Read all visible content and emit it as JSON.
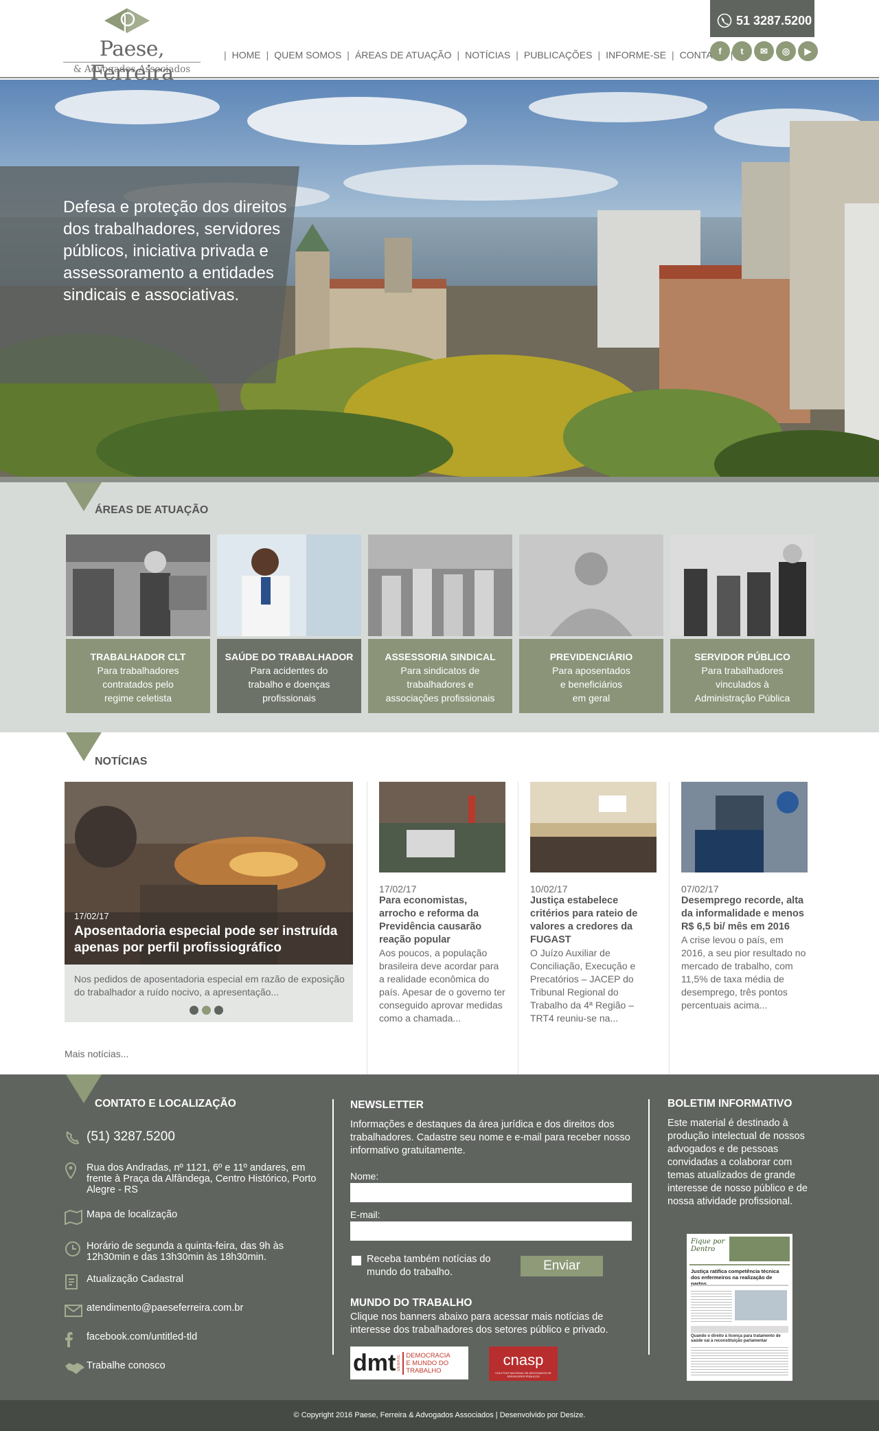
{
  "header": {
    "logo_name": "Paese, Ferreira",
    "logo_sub": "& Advogados Associados",
    "phone": "51 3287.5200",
    "nav": [
      "HOME",
      "QUEM SOMOS",
      "ÁREAS DE ATUAÇÃO",
      "NOTÍCIAS",
      "PUBLICAÇÕES",
      "INFORME-SE",
      "CONTATO"
    ],
    "social": [
      "facebook-icon",
      "twitter-icon",
      "email-icon",
      "instagram-icon",
      "youtube-icon"
    ]
  },
  "hero": {
    "text": "Defesa e proteção dos direitos dos trabalhadores, servidores públicos, iniciativa privada e assessoramento a entidades sindicais e associativas."
  },
  "areas": {
    "title": "ÁREAS DE ATUAÇÃO",
    "items": [
      {
        "title": "TRABALHADOR CLT",
        "desc1": "Para trabalhadores",
        "desc2": "contratados pelo",
        "desc3": "regime celetista"
      },
      {
        "title": "SAÚDE DO TRABALHADOR",
        "desc1": "Para acidentes do",
        "desc2": "trabalho e doenças",
        "desc3": "profissionais"
      },
      {
        "title": "ASSESSORIA SINDICAL",
        "desc1": "Para sindicatos de",
        "desc2": "trabalhadores e",
        "desc3": "associações profissionais"
      },
      {
        "title": "PREVIDENCIÁRIO",
        "desc1": "Para aposentados",
        "desc2": "e beneficiários",
        "desc3": "em geral"
      },
      {
        "title": "SERVIDOR PÚBLICO",
        "desc1": "Para trabalhadores",
        "desc2": "vinculados à",
        "desc3": "Administração Pública"
      }
    ]
  },
  "news": {
    "title": "NOTÍCIAS",
    "featured": {
      "date": "17/02/17",
      "title": "Aposentadoria especial pode ser instruída apenas por perfil profissiográfico",
      "summary": "Nos pedidos de aposentadoria especial em razão de exposição do trabalhador a ruído nocivo, a apresentação..."
    },
    "items": [
      {
        "date": "17/02/17",
        "title": "Para economistas, arrocho e reforma da Previdência causarão reação popular",
        "summary": "Aos poucos, a população brasileira deve acordar para a realidade econômica do país. Apesar de o governo ter conseguido aprovar medidas como a chamada..."
      },
      {
        "date": "10/02/17",
        "title": "Justiça estabelece critérios para rateio de valores a credores da FUGAST",
        "summary": "O Juízo Auxiliar de Conciliação, Execução e Precatórios – JACEP do Tribunal Regional do Trabalho da 4ª Região – TRT4 reuniu-se na..."
      },
      {
        "date": "07/02/17",
        "title": "Desemprego recorde, alta da informalidade e menos R$ 6,5 bi/ mês em 2016",
        "summary": "A crise levou o país, em 2016, a seu pior resultado no mercado de trabalho, com 11,5% de taxa média de desemprego, três pontos percentuais acima..."
      }
    ],
    "more": "Mais notícias..."
  },
  "footer": {
    "contact_title": "CONTATO E LOCALIZAÇÃO",
    "phone": "(51) 3287.5200",
    "address": "Rua dos Andradas, nº 1121, 6º e 11º andares, em frente à Praça da Alfândega, Centro Histórico, Porto Alegre - RS",
    "map": "Mapa de localização",
    "hours": "Horário de segunda a quinta-feira, das 9h às 12h30min e das 13h30min às 18h30min.",
    "update": "Atualização Cadastral",
    "email": "atendimento@paeseferreira.com.br",
    "facebook": "facebook.com/untitled-tld",
    "work": "Trabalhe conosco",
    "newsletter_title": "NEWSLETTER",
    "newsletter_text": "Informações e destaques da área jurídica e dos direitos dos trabalhadores. Cadastre seu nome e e-mail para receber nosso informativo gratuitamente.",
    "name_label": "Nome:",
    "email_label": "E-mail:",
    "check_label": "Receba também notícias do mundo do trabalho.",
    "submit": "Enviar",
    "mundo_title": "MUNDO DO TRABALHO",
    "mundo_text": "Clique nos banners abaixo para acessar mais notícias de interesse dos trabalhadores dos setores público e privado.",
    "banner1_main": "dmt",
    "banner1_side": "DEBATE",
    "banner1_text": "DEMOCRACIA E MUNDO DO TRABALHO",
    "banner2_main": "cnasp",
    "banner2_sub": "COLETIVO NACIONAL DE ADVOGADOS DE SERVIDORES PÚBLICOS",
    "boletim_title": "BOLETIM INFORMATIVO",
    "boletim_text": "Este material é destinado à produção intelectual de nossos advogados e de pessoas convidadas a colaborar com temas atualizados de grande interesse de nosso público e de nossa atividade profissional.",
    "boletim_cover_title": "Fique por Dentro",
    "boletim_cover_headline": "Justiça ratifica competência técnica dos enfermeiros na realização de partos",
    "boletim_cover_sub": "Quando o direito à licença para tratamento de saúde vai à reconstituição parlamentar"
  },
  "copyright": "© Copyright 2016 Paese, Ferreira & Advogados Associados  |  Desenvolvido por Desize.",
  "colors": {
    "olive": "#8e9a78",
    "dark_gray": "#60645f",
    "light_gray": "#d7dbd8"
  }
}
